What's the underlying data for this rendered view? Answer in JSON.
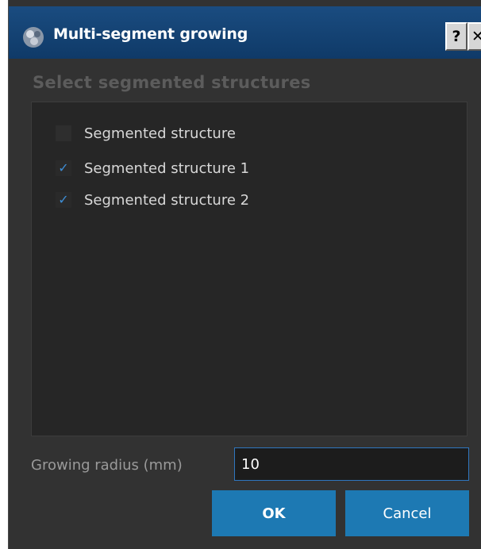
{
  "window": {
    "title": "Multi-segment growing",
    "help_label": "?",
    "close_label": "✕",
    "icon": "app-icon"
  },
  "group": {
    "title": "Select segmented structures",
    "items": [
      {
        "label": "Segmented structure",
        "checked": false,
        "mark": ""
      },
      {
        "label": "Segmented structure 1",
        "checked": true,
        "mark": "✓"
      },
      {
        "label": "Segmented structure 2",
        "checked": true,
        "mark": "✓"
      }
    ]
  },
  "radius": {
    "label": "Growing radius (mm)",
    "value": "10"
  },
  "buttons": {
    "ok_label": "OK",
    "cancel_label": "Cancel"
  },
  "colors": {
    "title_bar": "#1a4c80",
    "background": "#323232",
    "button": "#1d79b3",
    "check": "#3e8ed6"
  }
}
